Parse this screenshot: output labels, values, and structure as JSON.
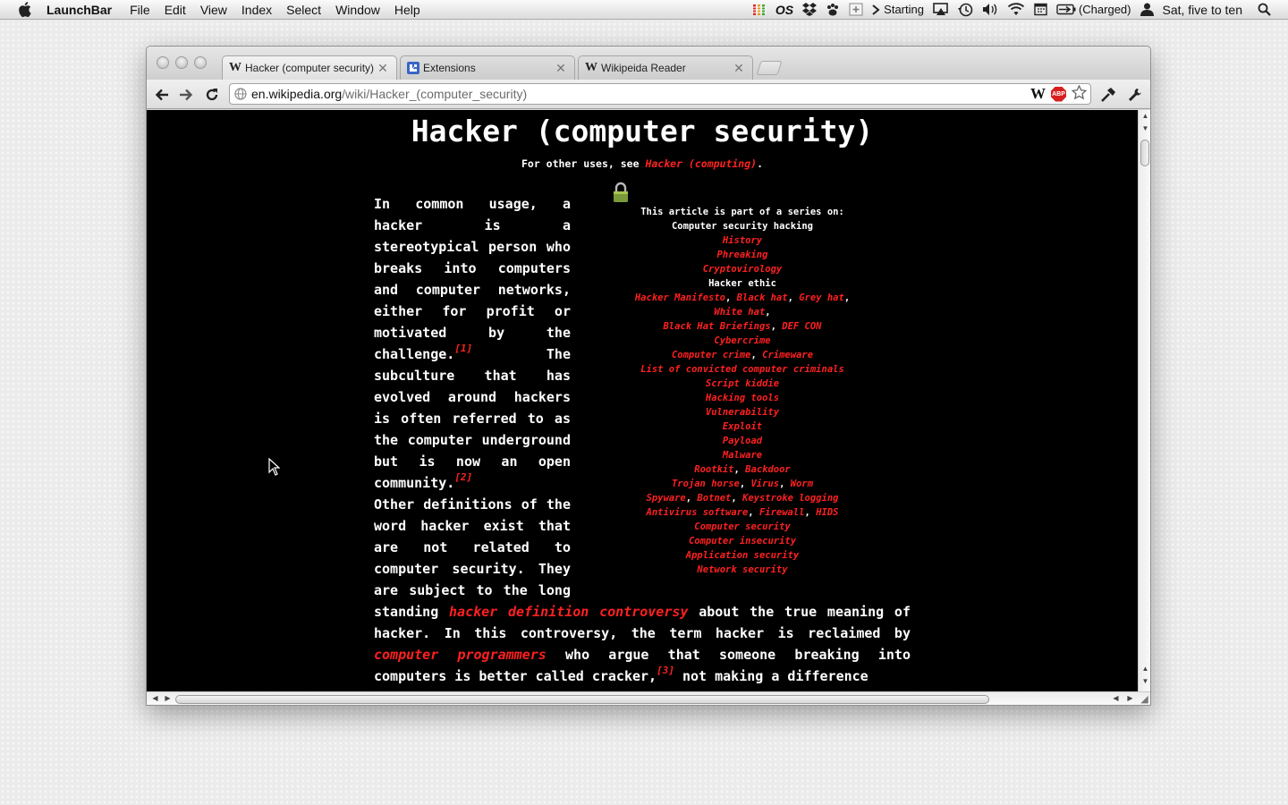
{
  "menubar": {
    "app_name": "LaunchBar",
    "menus": [
      "File",
      "Edit",
      "View",
      "Index",
      "Select",
      "Window",
      "Help"
    ],
    "status": {
      "os_label": "OS",
      "activity_label": "Starting",
      "battery_label": "(Charged)",
      "clock": "Sat, five to ten"
    }
  },
  "browser": {
    "tabs": [
      {
        "title": "Hacker (computer security)",
        "favicon": "W",
        "active": true
      },
      {
        "title": "Extensions",
        "favicon": "puzzle",
        "active": false
      },
      {
        "title": "Wikipeida Reader",
        "favicon": "W",
        "active": false
      }
    ],
    "url_host": "en.wikipedia.org",
    "url_path": "/wiki/Hacker_(computer_security)",
    "extension_w": "W",
    "adblock_label": "ABP"
  },
  "article": {
    "title": "Hacker (computer security)",
    "hatnote_prefix": "For other uses, see ",
    "hatnote_link": "Hacker (computing)",
    "hatnote_suffix": ".",
    "p1_a": "In common usage, a hacker is a stereotypical person who breaks into computers and computer networks, either for profit or motivated by the challenge.",
    "ref1": "[1]",
    "p1_b": " The subculture that has evolved around hackers is often referred to as the computer underground but is now an open community.",
    "ref2": "[2]",
    "p2_a": " Other definitions of the word hacker exist that are not related to computer security. They are subject to the long standing ",
    "p2_link1": "hacker definition controversy",
    "p2_b": " about the true meaning of hacker. In this controversy, the term hacker is reclaimed by ",
    "p2_link2": "computer programmers",
    "p2_c": " who argue that someone breaking into computers is better called cracker,",
    "ref3": "[3]",
    "p2_d": " not making a difference"
  },
  "infobox": {
    "heading": "This article is part of a series on:",
    "subject": "Computer security hacking",
    "history": "History",
    "phreaking": "Phreaking",
    "cryptovirology": "Cryptovirology",
    "hacker_ethic": "Hacker ethic",
    "manifesto": "Hacker Manifesto",
    "black_hat": "Black hat",
    "grey_hat": "Grey hat",
    "white_hat": "White hat",
    "briefings": "Black Hat Briefings",
    "defcon": "DEF CON",
    "cybercrime": "Cybercrime",
    "computer_crime": "Computer crime",
    "crimeware": "Crimeware",
    "criminals": "List of convicted computer criminals",
    "script_kiddie": "Script kiddie",
    "hacking_tools": "Hacking tools",
    "vulnerability": "Vulnerability",
    "exploit": "Exploit",
    "payload": "Payload",
    "malware": "Malware",
    "rootkit": "Rootkit",
    "backdoor": "Backdoor",
    "trojan": "Trojan horse",
    "virus": "Virus",
    "worm": "Worm",
    "spyware": "Spyware",
    "botnet": "Botnet",
    "keystroke": "Keystroke logging",
    "antivirus": "Antivirus software",
    "firewall": "Firewall",
    "hids": "HIDS",
    "computer_security": "Computer security",
    "computer_insecurity": "Computer insecurity",
    "application_security": "Application security",
    "network_security": "Network security",
    "comma": ", "
  },
  "colors": {
    "link": "#ff2020",
    "page_background": "#000000",
    "text": "#ffffff"
  }
}
